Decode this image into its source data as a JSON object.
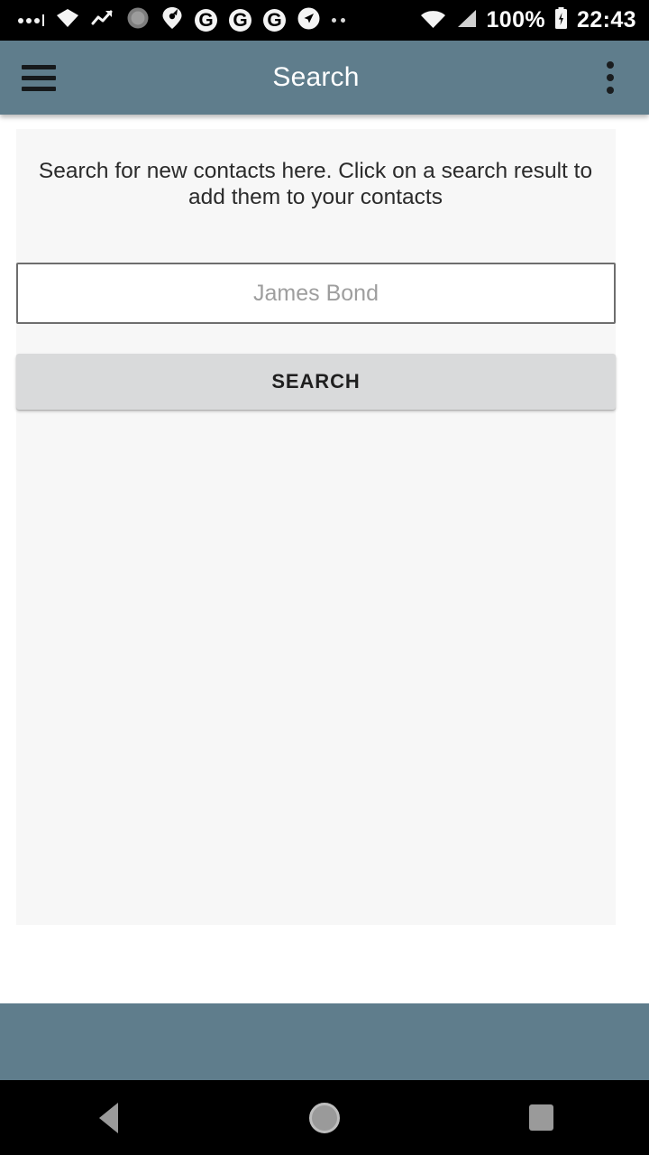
{
  "status_bar": {
    "icons_left": [
      {
        "name": "signal-dots-icon",
        "glyph": "dots"
      },
      {
        "name": "wifi-diamond-icon",
        "glyph": "wifi-diamond"
      },
      {
        "name": "trending-up-icon",
        "glyph": "trend"
      },
      {
        "name": "gear-circle-icon",
        "glyph": "gear"
      },
      {
        "name": "location-bird-icon",
        "glyph": "pin-bird"
      },
      {
        "name": "google-g-icon-1",
        "glyph": "G"
      },
      {
        "name": "google-g-icon-2",
        "glyph": "G"
      },
      {
        "name": "google-g-icon-3",
        "glyph": "G"
      },
      {
        "name": "navigation-arrow-icon",
        "glyph": "arrow"
      },
      {
        "name": "more-dots-icon",
        "glyph": "dots2"
      }
    ],
    "wifi_icon": "wifi-icon",
    "cellular_icon": "cellular-signal-icon",
    "battery_percent": "100%",
    "battery_icon": "battery-charging-icon",
    "clock": "22:43"
  },
  "app_bar": {
    "menu_icon": "hamburger-menu-icon",
    "title": "Search",
    "overflow_icon": "overflow-menu-icon"
  },
  "main": {
    "hint": "Search for new contacts here. Click on a search result to add them to your contacts",
    "search_field": {
      "value": "",
      "placeholder": "James Bond"
    },
    "search_button_label": "SEARCH",
    "results": []
  },
  "navigation_bar": {
    "back_label": "back-button",
    "home_label": "home-button",
    "recents_label": "recents-button"
  },
  "colors": {
    "app_bar": "#5f7d8c",
    "status_bar": "#000000",
    "panel": "#f7f7f7",
    "button": "#d9dadb",
    "nav_bar": "#000000"
  }
}
